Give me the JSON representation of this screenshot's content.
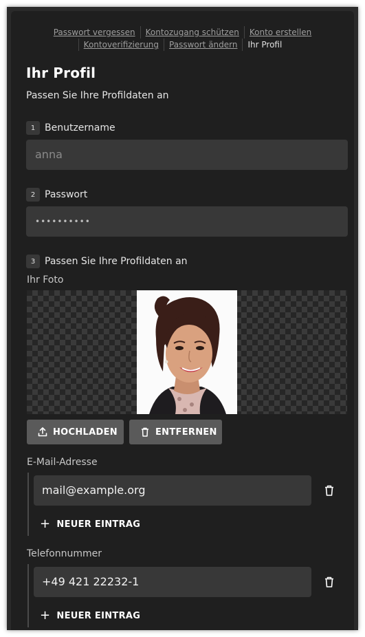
{
  "breadcrumb": {
    "links": [
      "Passwort vergessen",
      "Kontozugang schützen",
      "Konto erstellen",
      "Kontoverifizierung",
      "Passwort ändern"
    ],
    "current": "Ihr Profil"
  },
  "page": {
    "title": "Ihr Profil",
    "subtitle": "Passen Sie Ihre Profildaten an"
  },
  "steps": [
    {
      "number": "1",
      "label": "Benutzername"
    },
    {
      "number": "2",
      "label": "Passwort"
    },
    {
      "number": "3",
      "label": "Passen Sie Ihre Profildaten an"
    }
  ],
  "username": {
    "placeholder": "anna"
  },
  "password": {
    "value": "••••••••••"
  },
  "photo": {
    "label": "Ihr Foto",
    "upload_label": "HOCHLADEN",
    "remove_label": "ENTFERNEN"
  },
  "email": {
    "label": "E-Mail-Adresse",
    "entries": [
      "mail@example.org"
    ],
    "add_label": "NEUER EINTRAG"
  },
  "phone": {
    "label": "Telefonnummer",
    "entries": [
      "+49 421 22232-1"
    ],
    "add_label": "NEUER EINTRAG"
  },
  "icons": {
    "upload": "upload-icon",
    "remove": "trash-icon",
    "add": "plus-icon"
  }
}
